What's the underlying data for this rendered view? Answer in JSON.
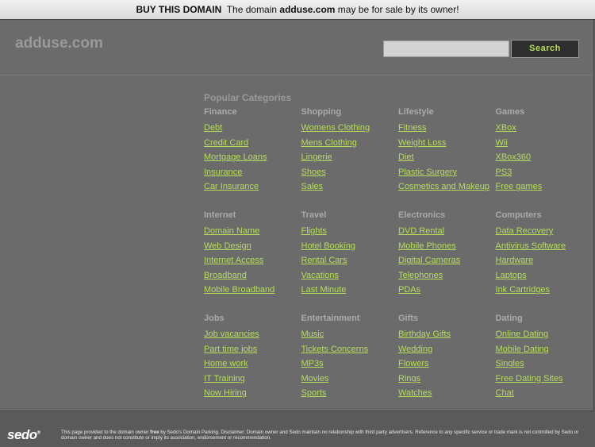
{
  "topbar": {
    "buy_label": "BUY THIS DOMAIN",
    "text_prefix": "The domain",
    "domain": "adduse.com",
    "text_suffix": "may be for sale by its owner!"
  },
  "header": {
    "site_name": "adduse.com",
    "search_placeholder": "",
    "search_button_label": "Search"
  },
  "popular_title": "Popular Categories",
  "categories": [
    {
      "title": "Finance",
      "links": [
        "Debt",
        "Credit Card",
        "Mortgage Loans",
        "Insurance",
        "Car Insurance"
      ]
    },
    {
      "title": "Shopping",
      "links": [
        "Womens Clothing",
        "Mens Clothing",
        "Lingerie",
        "Shoes",
        "Sales"
      ]
    },
    {
      "title": "Lifestyle",
      "links": [
        "Fitness",
        "Weight Loss",
        "Diet",
        "Plastic Surgery",
        "Cosmetics and Makeup"
      ]
    },
    {
      "title": "Games",
      "links": [
        "XBox",
        "Wii",
        "XBox360",
        "PS3",
        "Free games"
      ]
    },
    {
      "title": "Internet",
      "links": [
        "Domain Name",
        "Web Design",
        "Internet Access",
        "Broadband",
        "Mobile Broadband"
      ]
    },
    {
      "title": "Travel",
      "links": [
        "Flights",
        "Hotel Booking",
        "Rental Cars",
        "Vacations",
        "Last Minute"
      ]
    },
    {
      "title": "Electronics",
      "links": [
        "DVD Rental",
        "Mobile Phones",
        "Digital Cameras",
        "Telephones",
        "PDAs"
      ]
    },
    {
      "title": "Computers",
      "links": [
        "Data Recovery",
        "Antivirus Software",
        "Hardware",
        "Laptops",
        "Ink Cartridges"
      ]
    },
    {
      "title": "Jobs",
      "links": [
        "Job vacancies",
        "Part time jobs",
        "Home work",
        "IT Training",
        "Now Hiring"
      ]
    },
    {
      "title": "Entertainment",
      "links": [
        "Music",
        "Tickets Concerns",
        "MP3s",
        "Movies",
        "Sports"
      ]
    },
    {
      "title": "Gifts",
      "links": [
        "Birthday Gifts",
        "Wedding",
        "Flowers",
        "Rings",
        "Watches"
      ]
    },
    {
      "title": "Dating",
      "links": [
        "Online Dating",
        "Mobile Dating",
        "Singles",
        "Free Dating Sites",
        "Chat"
      ]
    }
  ],
  "footer": {
    "logo_text": "sedo",
    "logo_reg": "®",
    "text_part1": "This page provided to the domain owner",
    "text_bold": "free",
    "text_part2": "by Sedo's Domain Parking. Disclaimer: Domain owner and Sedo maintain no relationship with third party advertisers. Reference to any specific service or trade mark is not controlled by Sedo or domain owner and does not constitute or imply its association, endorsement or recommendation."
  },
  "colors": {
    "link": "#b7dd5a",
    "background": "#5a5a5a",
    "panel": "#6b6b6b"
  }
}
